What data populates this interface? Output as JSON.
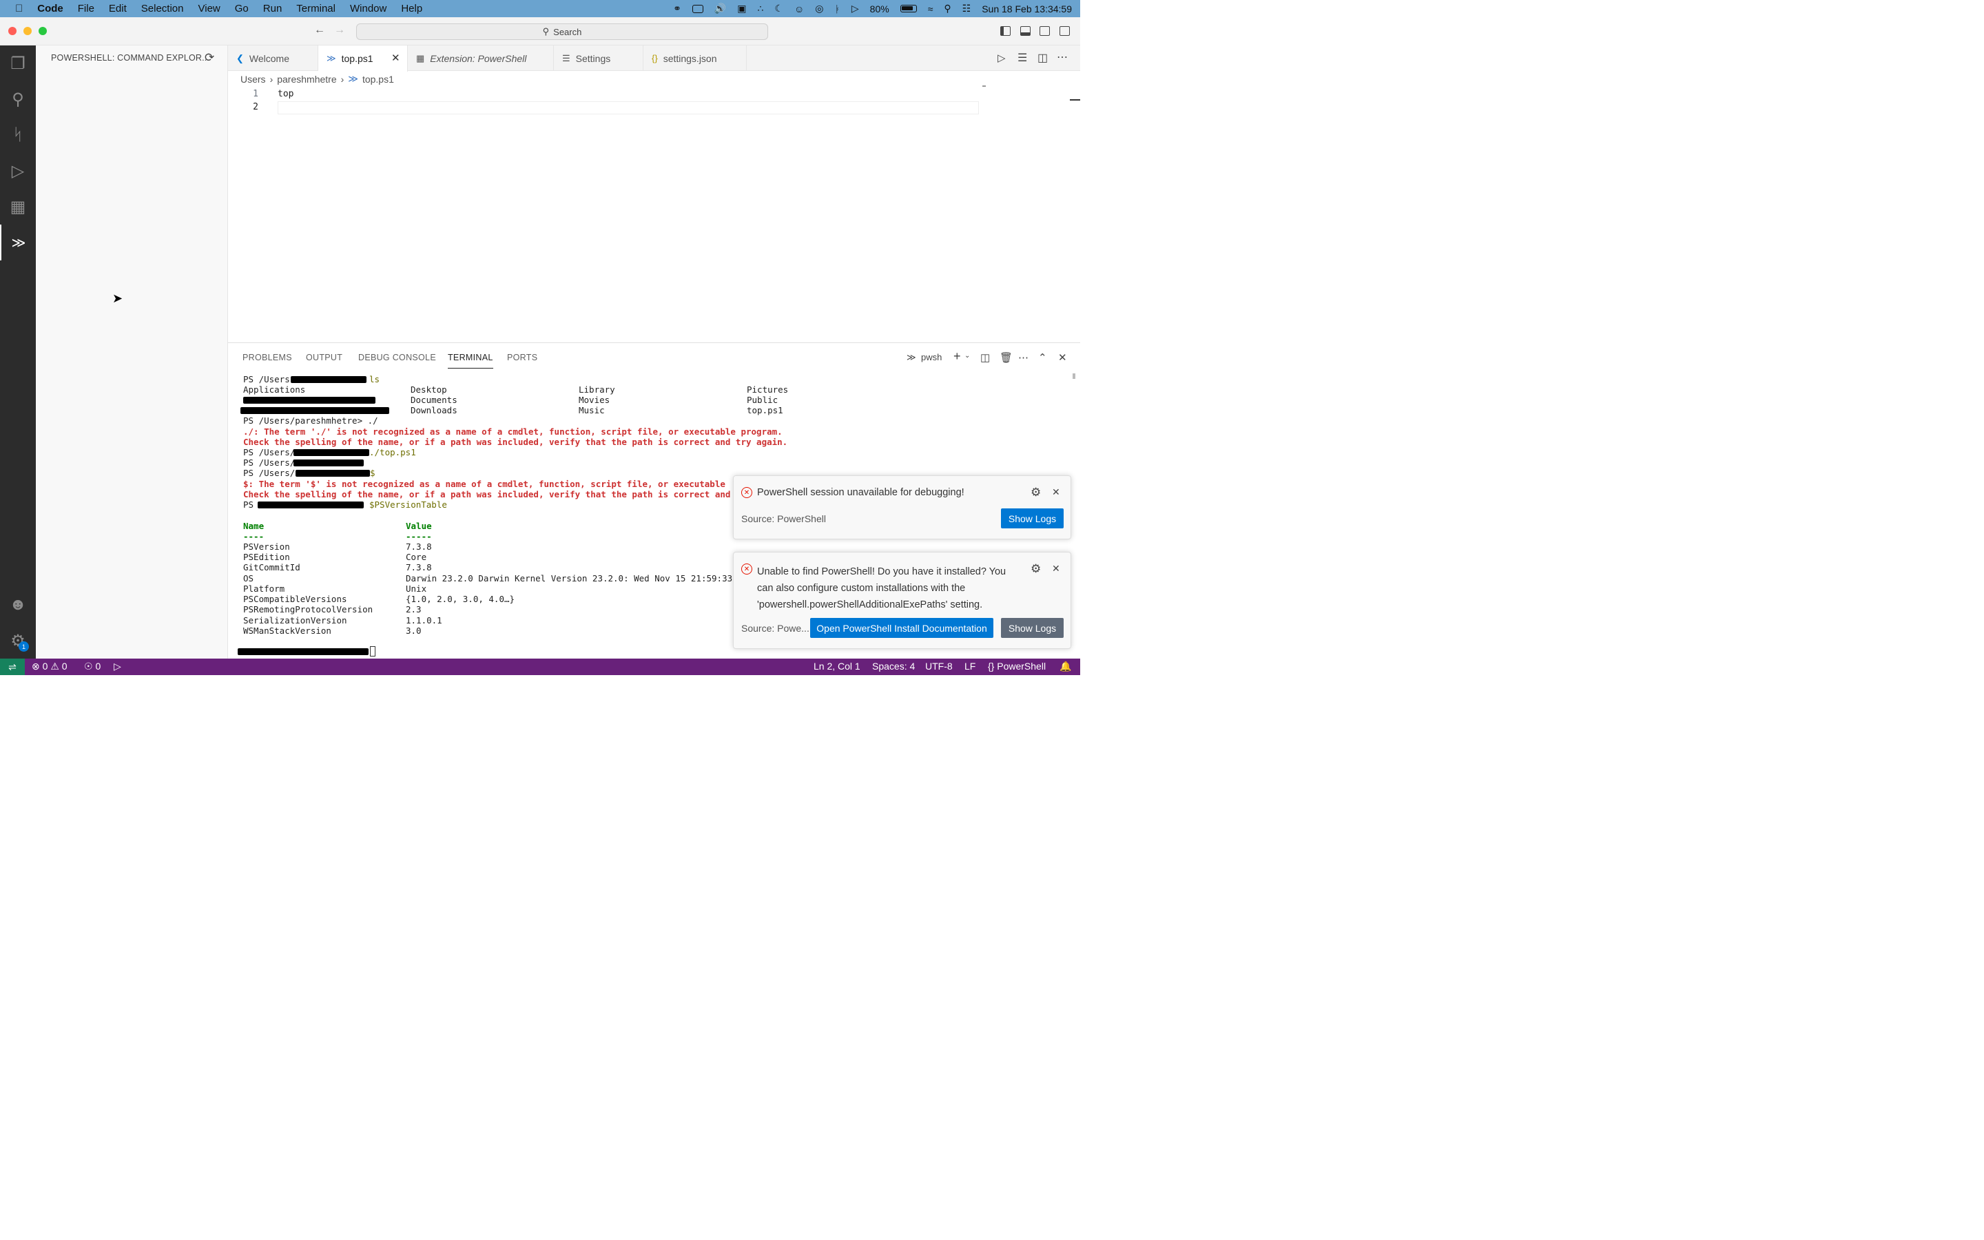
{
  "menubar": {
    "app": "Code",
    "items": [
      "File",
      "Edit",
      "Selection",
      "View",
      "Go",
      "Run",
      "Terminal",
      "Window",
      "Help"
    ],
    "battery": "80%",
    "datetime": "Sun 18 Feb  13:34:59"
  },
  "titlebar": {
    "search": "Search"
  },
  "sidebar": {
    "title": "POWERSHELL: COMMAND EXPLOR..."
  },
  "tabs": [
    {
      "label": "Welcome"
    },
    {
      "label": "top.ps1"
    },
    {
      "label": "Extension: PowerShell"
    },
    {
      "label": "Settings"
    },
    {
      "label": "settings.json"
    }
  ],
  "breadcrumb": [
    "Users",
    "pareshmhetre",
    "top.ps1"
  ],
  "editor": {
    "lines": [
      {
        "num": "1",
        "text": "top"
      },
      {
        "num": "2",
        "text": ""
      }
    ]
  },
  "panel": {
    "tabs": [
      "PROBLEMS",
      "OUTPUT",
      "DEBUG CONSOLE",
      "TERMINAL",
      "PORTS"
    ],
    "shell": "pwsh"
  },
  "terminal": {
    "l1_prompt": "PS /Users",
    "l1_cmd": "ls",
    "ls_col1": [
      "Applications",
      "",
      ""
    ],
    "ls_col2": [
      "Desktop",
      "Documents",
      "Downloads"
    ],
    "ls_col3": [
      "Library",
      "Movies",
      "Music"
    ],
    "ls_col4": [
      "Pictures",
      "Public",
      "top.ps1"
    ],
    "l5": "PS /Users/pareshmhetre> ./",
    "l6": "./: The term './' is not recognized as a name of a cmdlet, function, script file, or executable program.",
    "l7": "Check the spelling of the name, or if a path was included, verify that the path is correct and try again.",
    "l8_prompt": "PS /Users/",
    "l8_cmd": "./top.ps1",
    "l9_prompt": "PS /Users/",
    "l10_prompt": "PS /Users/",
    "l10_cmd": "$",
    "l11": "$: The term '$' is not recognized as a name of a cmdlet, function, script file, or executable",
    "l12": "Check the spelling of the name, or if a path was included, verify that the path is correct and",
    "l13_prompt": "PS",
    "l13_cmd": "$PSVersionTable",
    "table_header_name": "Name",
    "table_header_value": "Value",
    "table_sep_name": "----",
    "table_sep_value": "-----",
    "rows": [
      {
        "name": "PSVersion",
        "value": "7.3.8"
      },
      {
        "name": "PSEdition",
        "value": "Core"
      },
      {
        "name": "GitCommitId",
        "value": "7.3.8"
      },
      {
        "name": "OS",
        "value": "Darwin 23.2.0 Darwin Kernel Version 23.2.0: Wed Nov 15 21:59:33"
      },
      {
        "name": "Platform",
        "value": "Unix"
      },
      {
        "name": "PSCompatibleVersions",
        "value": "{1.0, 2.0, 3.0, 4.0…}"
      },
      {
        "name": "PSRemotingProtocolVersion",
        "value": "2.3"
      },
      {
        "name": "SerializationVersion",
        "value": "1.1.0.1"
      },
      {
        "name": "WSManStackVersion",
        "value": "3.0"
      }
    ]
  },
  "notifications": [
    {
      "message": "PowerShell session unavailable for debugging!",
      "source": "Source: PowerShell",
      "button": "Show Logs"
    },
    {
      "message_l1": "Unable to find PowerShell! Do you have it installed? You",
      "message_l2": "can also configure custom installations with the",
      "message_l3": "'powershell.powerShellAdditionalExePaths' setting.",
      "source": "Source: Powe...",
      "button_primary": "Open PowerShell Install Documentation",
      "button_secondary": "Show Logs"
    }
  ],
  "statusbar": {
    "errors": "0",
    "warnings": "0",
    "ports": "0",
    "position": "Ln 2, Col 1",
    "spaces": "Spaces: 4",
    "encoding": "UTF-8",
    "eol": "LF",
    "language": "PowerShell"
  },
  "activity_badge": "1",
  "colors": {
    "statusbar": "#68217a",
    "remote": "#16825d",
    "accent": "#0078d4",
    "error": "#cd3131"
  }
}
